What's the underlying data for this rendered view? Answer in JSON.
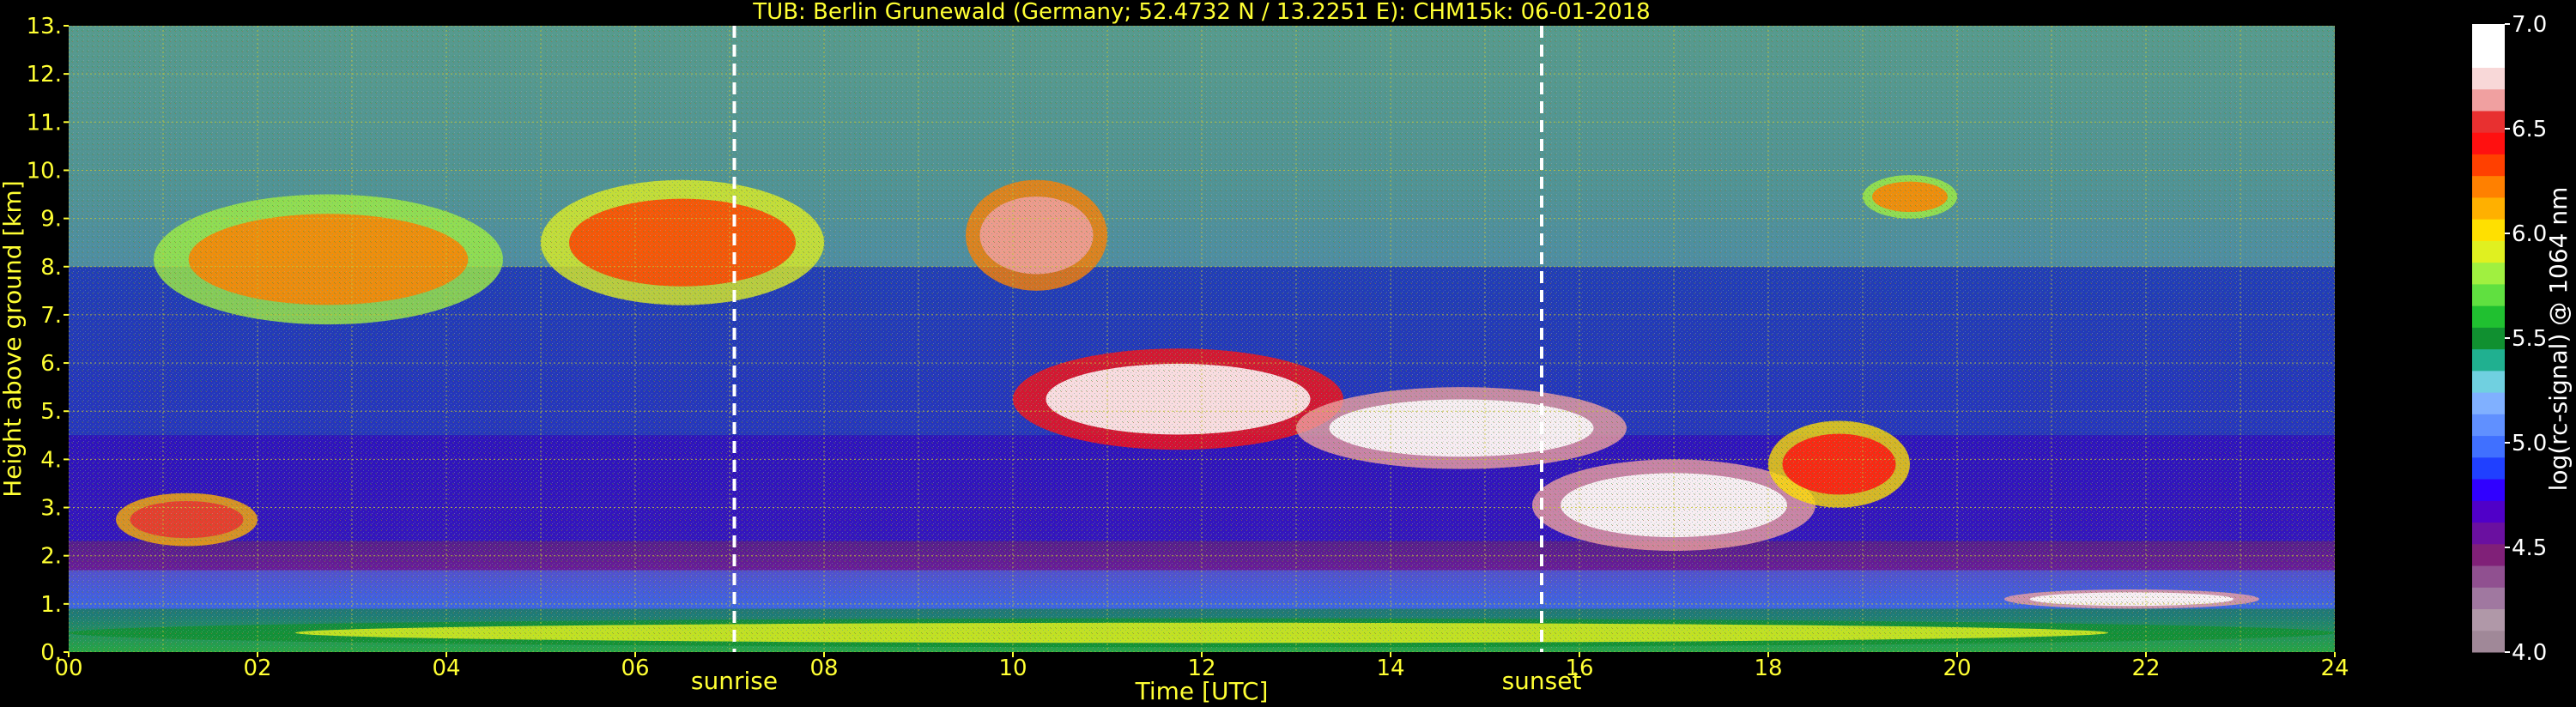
{
  "chart_data": {
    "type": "heatmap",
    "title": "TUB: Berlin Grunewald (Germany; 52.4732 N / 13.2251 E):    CHM15k: 06-01-2018",
    "xlabel": "Time [UTC]",
    "ylabel": "Height above ground [km]",
    "xlim": [
      0,
      24
    ],
    "ylim": [
      0,
      13
    ],
    "x_ticks": [
      {
        "value": 0,
        "label": "00"
      },
      {
        "value": 2,
        "label": "02"
      },
      {
        "value": 4,
        "label": "04"
      },
      {
        "value": 6,
        "label": "06"
      },
      {
        "value": 8,
        "label": "08"
      },
      {
        "value": 10,
        "label": "10"
      },
      {
        "value": 12,
        "label": "12"
      },
      {
        "value": 14,
        "label": "14"
      },
      {
        "value": 16,
        "label": "16"
      },
      {
        "value": 18,
        "label": "18"
      },
      {
        "value": 20,
        "label": "20"
      },
      {
        "value": 22,
        "label": "22"
      },
      {
        "value": 24,
        "label": "24"
      }
    ],
    "y_ticks": [
      {
        "value": 0,
        "label": "0."
      },
      {
        "value": 1,
        "label": "1."
      },
      {
        "value": 2,
        "label": "2."
      },
      {
        "value": 3,
        "label": "3."
      },
      {
        "value": 4,
        "label": "4."
      },
      {
        "value": 5,
        "label": "5."
      },
      {
        "value": 6,
        "label": "6."
      },
      {
        "value": 7,
        "label": "7."
      },
      {
        "value": 8,
        "label": "8."
      },
      {
        "value": 9,
        "label": "9."
      },
      {
        "value": 10,
        "label": "10."
      },
      {
        "value": 11,
        "label": "11."
      },
      {
        "value": 12,
        "label": "12."
      },
      {
        "value": 13,
        "label": "13."
      }
    ],
    "grid": true,
    "markers": [
      {
        "name": "sunrise",
        "x": 7.05
      },
      {
        "name": "sunset",
        "x": 15.6
      }
    ],
    "colorbar": {
      "label": "log(rc-signal) @ 1064 nm",
      "range": [
        4.0,
        7.0
      ],
      "ticks": [
        {
          "value": 4.0,
          "label": "4.0"
        },
        {
          "value": 4.5,
          "label": "4.5"
        },
        {
          "value": 5.0,
          "label": "5.0"
        },
        {
          "value": 5.5,
          "label": "5.5"
        },
        {
          "value": 6.0,
          "label": "6.0"
        },
        {
          "value": 6.5,
          "label": "6.5"
        },
        {
          "value": 7.0,
          "label": "7.0"
        }
      ],
      "colors": [
        "#a08898",
        "#b098a8",
        "#a078a0",
        "#905090",
        "#802078",
        "#6a10a0",
        "#5000c8",
        "#3000ff",
        "#2040ff",
        "#4070ff",
        "#6090ff",
        "#80b0ff",
        "#70d0e0",
        "#20b090",
        "#109030",
        "#20c030",
        "#60e040",
        "#a0f040",
        "#e0f020",
        "#ffe000",
        "#ffb000",
        "#ff8000",
        "#ff4000",
        "#ff1010",
        "#e83030",
        "#f0a0a0",
        "#f8d8d8",
        "#ffffff",
        "#ffffff"
      ]
    },
    "layers": [
      {
        "x": [
          0,
          24
        ],
        "y": [
          0,
          0.9
        ],
        "value": 5.5
      },
      {
        "x": [
          0,
          24
        ],
        "y": [
          0.9,
          1.7
        ],
        "value": 5.0
      },
      {
        "x": [
          0,
          24
        ],
        "y": [
          1.7,
          2.3
        ],
        "value": 4.6
      },
      {
        "x": [
          0,
          24
        ],
        "y": [
          2.3,
          4.5
        ],
        "value": 4.8
      },
      {
        "x": [
          0,
          24
        ],
        "y": [
          4.5,
          8.0
        ],
        "value": 4.9
      },
      {
        "x": [
          0,
          24
        ],
        "y": [
          8.0,
          13.0
        ],
        "value": 5.3
      }
    ],
    "features": [
      {
        "x": [
          0.9,
          4.6
        ],
        "y": [
          6.8,
          9.5
        ],
        "value": 6.2
      },
      {
        "x": [
          5.0,
          8.0
        ],
        "y": [
          7.2,
          9.8
        ],
        "value": 6.3
      },
      {
        "x": [
          9.5,
          11.0
        ],
        "y": [
          7.5,
          9.8
        ],
        "value": 6.6
      },
      {
        "x": [
          10.0,
          13.5
        ],
        "y": [
          4.2,
          6.3
        ],
        "value": 6.8
      },
      {
        "x": [
          13.0,
          16.5
        ],
        "y": [
          3.8,
          5.5
        ],
        "value": 7.0
      },
      {
        "x": [
          15.5,
          18.5
        ],
        "y": [
          2.1,
          4.0
        ],
        "value": 7.0
      },
      {
        "x": [
          18.0,
          19.5
        ],
        "y": [
          3.0,
          4.8
        ],
        "value": 6.4
      },
      {
        "x": [
          19.0,
          20.0
        ],
        "y": [
          9.0,
          9.9
        ],
        "value": 6.2
      },
      {
        "x": [
          0.5,
          2.0
        ],
        "y": [
          2.2,
          3.3
        ],
        "value": 6.5
      },
      {
        "x": [
          20.5,
          23.2
        ],
        "y": [
          0.9,
          1.3
        ],
        "value": 7.0
      },
      {
        "x": [
          0,
          24
        ],
        "y": [
          0.1,
          0.7
        ],
        "value": 5.9
      }
    ]
  }
}
